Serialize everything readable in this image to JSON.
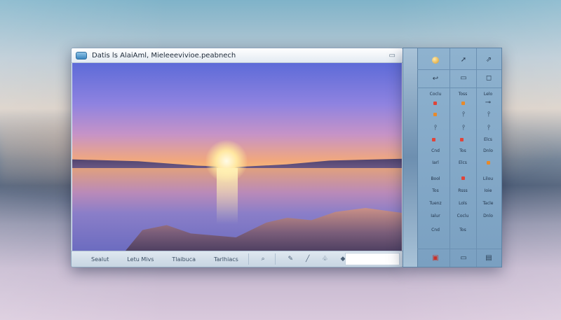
{
  "window": {
    "title": "Datis ls AlaiAml, Mieleeevivioe.peabnech"
  },
  "statusbar": {
    "items": [
      "Sealut",
      "Letu Mivs",
      "Tlaibuca",
      "Tarlhiacs"
    ],
    "tools": [
      "⌕",
      "✎",
      "╱",
      "♧",
      "◆"
    ]
  },
  "sidepanel": {
    "header_icons": [
      "coin-icon",
      "pointer-icon",
      "expand-icon"
    ],
    "row2_icons": [
      "back-icon",
      "monitor-icon",
      "chat-icon"
    ],
    "labels": {
      "r1": [
        "Coclu",
        "Toss",
        "Lelo"
      ],
      "r2": [
        "Cnd",
        "Tos",
        "Elcs"
      ],
      "r3": [
        "Iarl",
        "Elcs",
        "Dnlo"
      ],
      "r4": [
        "Bool",
        "Tos",
        "Lilou"
      ],
      "r5": [
        "Tuenz",
        "Rsss",
        "Ioie"
      ],
      "r6": [
        "Ialur",
        "Lols",
        "Tacle"
      ]
    },
    "colors": {
      "red": "#e0443a",
      "orange": "#e88a2a",
      "green": "#3aa86a"
    }
  }
}
